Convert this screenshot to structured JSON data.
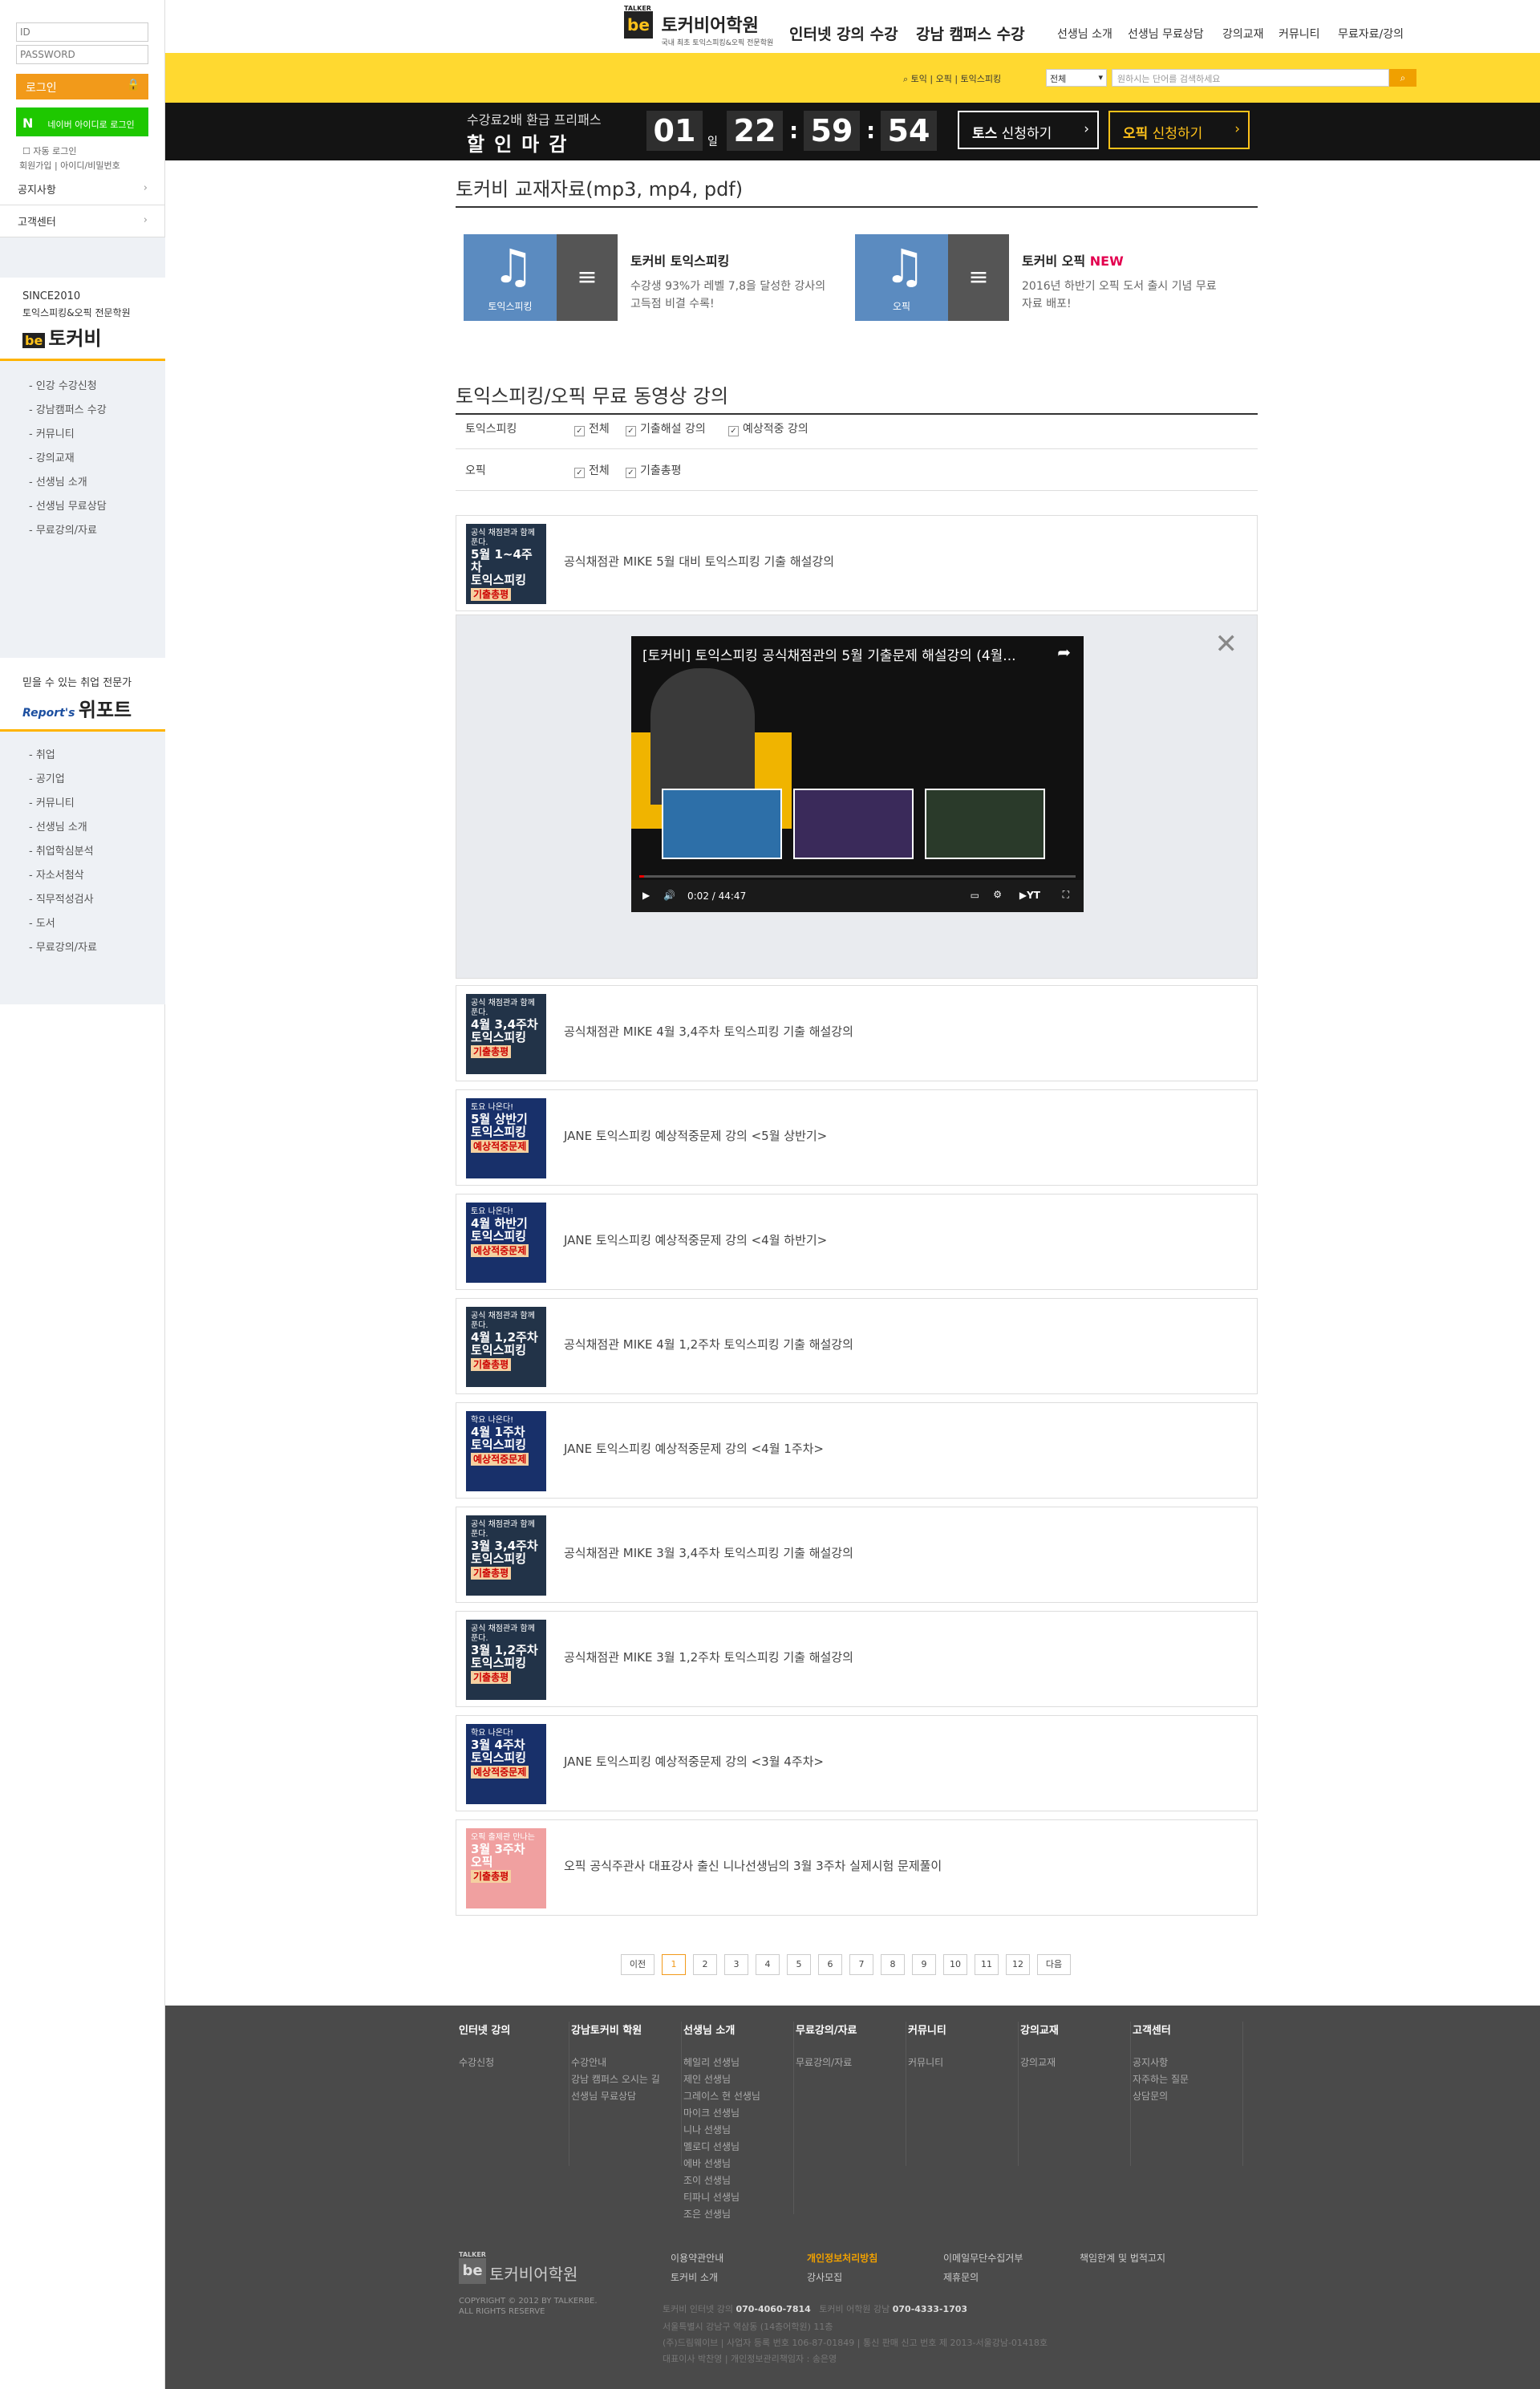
{
  "login": {
    "id_placeholder": "ID",
    "pw_placeholder": "PASSWORD",
    "login_label": "로그인",
    "naver_label": "네이버 아이디로 로그인",
    "auto_login": "자동 로그인",
    "links": "회원가입 | 아이디/비밀번호"
  },
  "left_menu": [
    {
      "label": "공지사항"
    },
    {
      "label": "고객센터"
    }
  ],
  "brand1": {
    "since": "SINCE2010",
    "sub": "토익스피킹&오픽 전문학원",
    "name": "토커비"
  },
  "brand1_items": [
    "- 인강 수강신청",
    "- 강남캠퍼스 수강",
    "- 커뮤니티",
    "- 강의교재",
    "- 선생님 소개",
    "- 선생님 무료상담",
    "- 무료강의/자료"
  ],
  "brand2": {
    "sub": "믿을 수 있는 취업 전문가",
    "logo": "Report's",
    "name": "위포트"
  },
  "brand2_items": [
    "- 취업",
    "- 공기업",
    "- 커뮤니티",
    "- 선생님 소개",
    "- 취업학심분석",
    "- 자소서첨삭",
    "- 직무적성검사",
    "- 도서",
    "- 무료강의/자료"
  ],
  "header": {
    "logo_small": "TALKER",
    "logo_be": "be",
    "logo_name": "토커비어학원",
    "logo_sub": "국내 최초 토익스피킹&오픽 전문학원",
    "main_nav": [
      "인터넷 강의 수강",
      "강남 캠퍼스 수강"
    ],
    "sub_nav": [
      "선생님 소개",
      "선생님 무료상담",
      "강의교재",
      "커뮤니티",
      "무료자료/강의"
    ]
  },
  "search": {
    "links": "토익 | 오픽 | 토익스피킹",
    "select": "전체",
    "placeholder": "원하시는 단어를 검색하세요"
  },
  "timer": {
    "line1": "수강료2배 환급 프리패스",
    "line2": "할인마감",
    "days": "01",
    "day_unit": "일",
    "hh": "22",
    "mm": "59",
    "ss": "54",
    "btn1_a": "토스",
    "btn1_b": " 신청하기",
    "btn2_a": "오픽",
    "btn2_b": " 신청하기"
  },
  "materials": {
    "title": "토커비 교재자료(mp3, mp4, pdf)",
    "cards": [
      {
        "label": "토익스피킹",
        "title": "토커비 토익스피킹",
        "new": "",
        "desc": "수강생 93%가 레벨 7,8을 달성한 강사의 고득점 비결 수록!"
      },
      {
        "label": "오픽",
        "title": "토커비 오픽 ",
        "new": "NEW",
        "desc": "2016년 하반기 오픽 도서 출시 기념 무료자료 배포!"
      }
    ]
  },
  "videos": {
    "title": "토익스피킹/오픽 무료 동영상 강의",
    "filters": [
      {
        "label": "토익스피킹",
        "options": [
          "전체",
          "기출해설 강의",
          "예상적중 강의"
        ]
      },
      {
        "label": "오픽",
        "options": [
          "전체",
          "기출총평"
        ]
      }
    ],
    "player": {
      "title": "[토커비] 토익스피킹 공식채점관의 5월 기출문제 해설강의 (4월...",
      "time": "0:02 / 44:47"
    },
    "items": [
      {
        "t1": "공식 채점관과 함께 푼다.",
        "t2": "5월 1~4주차",
        "t3": "토익스피킹",
        "tag": "기출총평",
        "title": "공식채점관 MIKE 5월 대비 토익스피킹 기출 해설강의"
      },
      {
        "t1": "공식 채점관과 함께 푼다.",
        "t2": "4월 3,4주차",
        "t3": "토익스피킹",
        "tag": "기출총평",
        "title": "공식채점관 MIKE 4월 3,4주차 토익스피킹 기출 해설강의"
      },
      {
        "t1": "토요 나온다!",
        "t2": "5월 상반기",
        "t3": "토익스피킹",
        "tag": "예상적중문제",
        "title": "JANE 토익스피킹 예상적중문제 강의 <5월 상반기>"
      },
      {
        "t1": "토요 나온다!",
        "t2": "4월 하반기",
        "t3": "토익스피킹",
        "tag": "예상적중문제",
        "title": "JANE 토익스피킹 예상적중문제 강의 <4월 하반기>"
      },
      {
        "t1": "공식 채점관과 함께 푼다.",
        "t2": "4월 1,2주차",
        "t3": "토익스피킹",
        "tag": "기출총평",
        "title": "공식채점관 MIKE 4월 1,2주차 토익스피킹 기출 해설강의"
      },
      {
        "t1": "학요 나온다!",
        "t2": "4월 1주차",
        "t3": "토익스피킹",
        "tag": "예상적중문제",
        "title": "JANE 토익스피킹 예상적중문제 강의 <4월 1주차>"
      },
      {
        "t1": "공식 채점관과 함께 푼다.",
        "t2": "3월 3,4주차",
        "t3": "토익스피킹",
        "tag": "기출총평",
        "title": "공식채점관 MIKE 3월 3,4주차 토익스피킹 기출 해설강의"
      },
      {
        "t1": "공식 채점관과 함께 푼다.",
        "t2": "3월 1,2주차",
        "t3": "토익스피킹",
        "tag": "기출총평",
        "title": "공식채점관 MIKE 3월 1,2주차 토익스피킹 기출 해설강의"
      },
      {
        "t1": "학요 나온다!",
        "t2": "3월 4주차",
        "t3": "토익스피킹",
        "tag": "예상적중문제",
        "title": "JANE 토익스피킹 예상적중문제 강의 <3월 4주차>"
      },
      {
        "t1": "오픽 출제관 만나는",
        "t2": "3월 3주차",
        "t3": "오픽",
        "tag": "기출총평",
        "title": "오픽 공식주관사 대표강사 출신 니나선생님의 3월 3주차 실제시험 문제풀이"
      }
    ]
  },
  "pagination": [
    "이전",
    "1",
    "2",
    "3",
    "4",
    "5",
    "6",
    "7",
    "8",
    "9",
    "10",
    "11",
    "12",
    "다음"
  ],
  "footer": {
    "cols": [
      {
        "h": "인터넷 강의",
        "items": [
          "수강신청"
        ]
      },
      {
        "h": "강남토커비 학원",
        "items": [
          "수강안내",
          "강남 캠퍼스 오시는 길",
          "선생님 무료상담"
        ]
      },
      {
        "h": "선생님 소개",
        "items": [
          "헤일리 선생님",
          "제인 선생님",
          "그레이스 현 선생님",
          "마이크 선생님",
          "니나 선생님",
          "멜로디 선생님",
          "에바 선생님",
          "조이 선생님",
          "티파니 선생님",
          "조은 선생님"
        ]
      },
      {
        "h": "무료강의/자료",
        "items": [
          "무료강의/자료"
        ]
      },
      {
        "h": "커뮤니티",
        "items": [
          "커뮤니티"
        ]
      },
      {
        "h": "강의교재",
        "items": [
          "강의교재"
        ]
      },
      {
        "h": "고객센터",
        "items": [
          "공지사항",
          "자주하는 질문",
          "상담문의"
        ]
      }
    ],
    "logo_small": "TALKER",
    "logo_be": "be",
    "logo_name": "토커비어학원",
    "copyright": "COPYRIGHT © 2012 BY TALKERBE. ALL RIGHTS RESERVE",
    "links": [
      "이용약관안내",
      "개인정보처리방침",
      "이메일무단수집거부",
      "책임한계 및 법적고지",
      "토커비 소개",
      "강사모집",
      "제휴문의"
    ],
    "info1_a": "토커비 인터넷 강의",
    "info1_phone": "070-4060-7814",
    "info1_b": "토커비 어학원 강남",
    "info1_phone2": "070-4333-1703",
    "info2": "서울특별시 강남구 역삼동 (14층어학원) 11층",
    "info3": "(주)드림웨이브 | 사업자 등록 번호 106-87-01849 | 통신 판매 신고 번호 제 2013-서울강남-01418호",
    "info4": "대표이사 박찬영 | 개인정보관리책임자 : 송은영"
  }
}
